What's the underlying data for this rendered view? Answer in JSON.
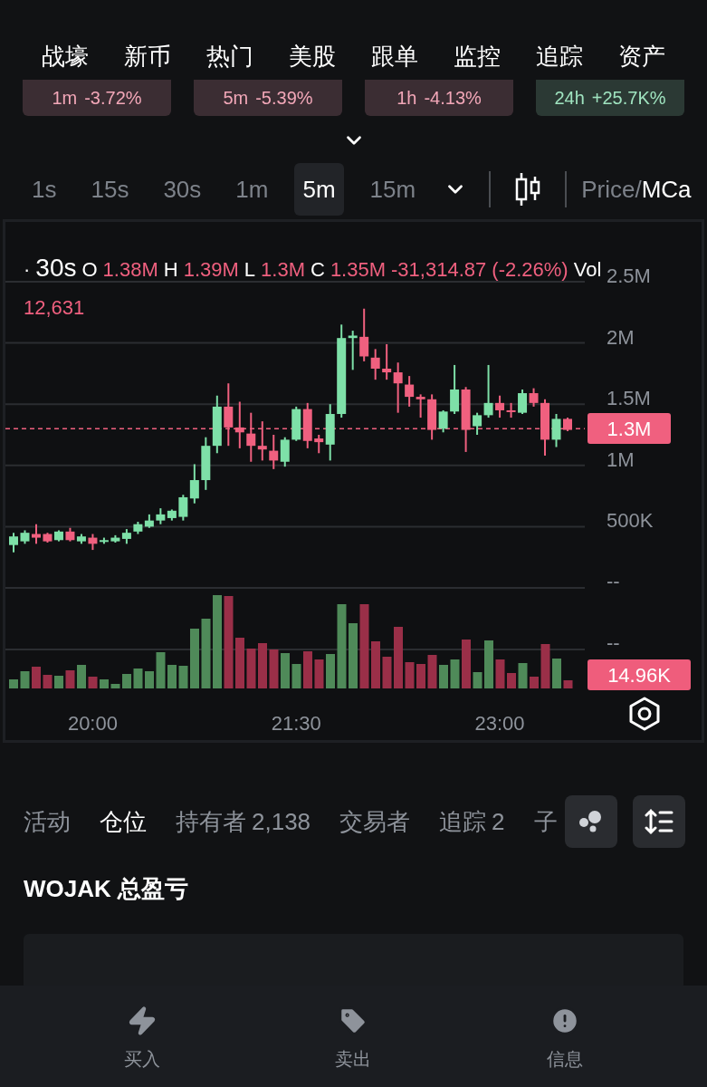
{
  "top_tabs": [
    {
      "label": "战壕"
    },
    {
      "label": "新币"
    },
    {
      "label": "热门"
    },
    {
      "label": "美股"
    },
    {
      "label": "跟单"
    },
    {
      "label": "监控"
    },
    {
      "label": "追踪"
    },
    {
      "label": "资产"
    }
  ],
  "changes": [
    {
      "period": "1m",
      "value": "-3.72%",
      "color": "#f2a7b8"
    },
    {
      "period": "5m",
      "value": "-5.39%",
      "color": "#f2a7b8"
    },
    {
      "period": "1h",
      "value": "-4.13%",
      "color": "#f2a7b8"
    },
    {
      "period": "24h",
      "value": "+25.7K%",
      "color": "#9fe3bf"
    }
  ],
  "intervals": [
    {
      "label": "1s",
      "selected": false
    },
    {
      "label": "15s",
      "selected": false
    },
    {
      "label": "30s",
      "selected": false
    },
    {
      "label": "1m",
      "selected": false
    },
    {
      "label": "5m",
      "selected": true
    },
    {
      "label": "15m",
      "selected": false
    }
  ],
  "display_toggle": {
    "separator": "/",
    "options": [
      {
        "label": "Price",
        "selected": false
      },
      {
        "label": "MCa",
        "selected": true
      }
    ]
  },
  "chart": {
    "legend": {
      "bullet": "·",
      "interval": "30s",
      "items": [
        {
          "label": "O",
          "value": "1.38M"
        },
        {
          "label": "H",
          "value": "1.39M"
        },
        {
          "label": "L",
          "value": "1.3M"
        },
        {
          "label": "C",
          "value": "1.35M"
        }
      ],
      "change": "-31,314.87 (-2.26%)",
      "vol_label": "Vol",
      "vol_value": "12,631"
    },
    "chart_data": {
      "type": "candlestick",
      "categories": [
        null,
        null,
        null,
        null,
        null,
        null,
        null,
        "20:00",
        null,
        null,
        null,
        null,
        null,
        null,
        null,
        null,
        null,
        null,
        null,
        null,
        null,
        null,
        null,
        null,
        null,
        "21:30",
        null,
        null,
        null,
        null,
        null,
        null,
        null,
        null,
        null,
        null,
        null,
        null,
        null,
        null,
        null,
        null,
        null,
        "23:00",
        null,
        null,
        null,
        null,
        null,
        null
      ],
      "ohlc": [
        [
          350000,
          450000,
          290000,
          420000
        ],
        [
          380000,
          470000,
          360000,
          450000
        ],
        [
          440000,
          520000,
          360000,
          410000
        ],
        [
          440000,
          450000,
          370000,
          380000
        ],
        [
          390000,
          470000,
          380000,
          460000
        ],
        [
          460000,
          490000,
          380000,
          390000
        ],
        [
          380000,
          440000,
          360000,
          420000
        ],
        [
          410000,
          440000,
          310000,
          360000
        ],
        [
          380000,
          410000,
          360000,
          390000
        ],
        [
          380000,
          430000,
          370000,
          410000
        ],
        [
          400000,
          480000,
          360000,
          450000
        ],
        [
          460000,
          540000,
          440000,
          520000
        ],
        [
          500000,
          600000,
          490000,
          550000
        ],
        [
          550000,
          650000,
          520000,
          600000
        ],
        [
          570000,
          640000,
          550000,
          630000
        ],
        [
          580000,
          760000,
          550000,
          740000
        ],
        [
          730000,
          1010000,
          690000,
          880000
        ],
        [
          880000,
          1230000,
          800000,
          1160000
        ],
        [
          1160000,
          1570000,
          1100000,
          1480000
        ],
        [
          1480000,
          1670000,
          1160000,
          1310000
        ],
        [
          1310000,
          1520000,
          1140000,
          1270000
        ],
        [
          1260000,
          1430000,
          1030000,
          1160000
        ],
        [
          1160000,
          1360000,
          1040000,
          1130000
        ],
        [
          1120000,
          1250000,
          970000,
          1040000
        ],
        [
          1030000,
          1230000,
          990000,
          1210000
        ],
        [
          1210000,
          1480000,
          1200000,
          1460000
        ],
        [
          1460000,
          1510000,
          1140000,
          1200000
        ],
        [
          1220000,
          1250000,
          1100000,
          1190000
        ],
        [
          1170000,
          1500000,
          1040000,
          1420000
        ],
        [
          1420000,
          2150000,
          1390000,
          2040000
        ],
        [
          2040000,
          2100000,
          1780000,
          2060000
        ],
        [
          2050000,
          2280000,
          1850000,
          1890000
        ],
        [
          1880000,
          1950000,
          1700000,
          1790000
        ],
        [
          1790000,
          1990000,
          1700000,
          1760000
        ],
        [
          1760000,
          1840000,
          1430000,
          1670000
        ],
        [
          1660000,
          1730000,
          1480000,
          1560000
        ],
        [
          1560000,
          1580000,
          1390000,
          1540000
        ],
        [
          1540000,
          1580000,
          1210000,
          1290000
        ],
        [
          1300000,
          1450000,
          1270000,
          1440000
        ],
        [
          1440000,
          1820000,
          1420000,
          1620000
        ],
        [
          1620000,
          1640000,
          1110000,
          1290000
        ],
        [
          1320000,
          1430000,
          1250000,
          1410000
        ],
        [
          1410000,
          1820000,
          1390000,
          1510000
        ],
        [
          1510000,
          1570000,
          1390000,
          1450000
        ],
        [
          1450000,
          1510000,
          1390000,
          1440000
        ],
        [
          1430000,
          1620000,
          1420000,
          1590000
        ],
        [
          1590000,
          1630000,
          1480000,
          1510000
        ],
        [
          1510000,
          1540000,
          1080000,
          1210000
        ],
        [
          1210000,
          1420000,
          1150000,
          1380000
        ],
        [
          1380000,
          1390000,
          1280000,
          1290000
        ]
      ],
      "ylim": [
        0,
        2500000
      ],
      "grid": true,
      "ref_lines": [
        {
          "axis": "y",
          "value": 1300000,
          "label": "1.3M",
          "color": "#f0607f"
        }
      ],
      "yticks": [
        {
          "value": 2500000,
          "label": "2.5M"
        },
        {
          "value": 2000000,
          "label": "2M"
        },
        {
          "value": 1500000,
          "label": "1.5M"
        },
        {
          "value": 1000000,
          "label": "1M"
        },
        {
          "value": 500000,
          "label": "500K"
        }
      ]
    },
    "volume_labels": [
      "--",
      "--"
    ],
    "volume_tag": "14.96K"
  },
  "section_tabs": [
    {
      "label": "活动",
      "selected": false
    },
    {
      "label": "仓位",
      "selected": true
    },
    {
      "label": "持有者",
      "count": "2,138",
      "selected": false
    },
    {
      "label": "交易者",
      "selected": false
    },
    {
      "label": "追踪",
      "count": "2",
      "selected": false
    },
    {
      "label": "子",
      "selected": false
    }
  ],
  "section_title": "WOJAK 总盈亏",
  "bottom_nav": [
    {
      "label": "买入"
    },
    {
      "label": "卖出"
    },
    {
      "label": "信息"
    }
  ]
}
